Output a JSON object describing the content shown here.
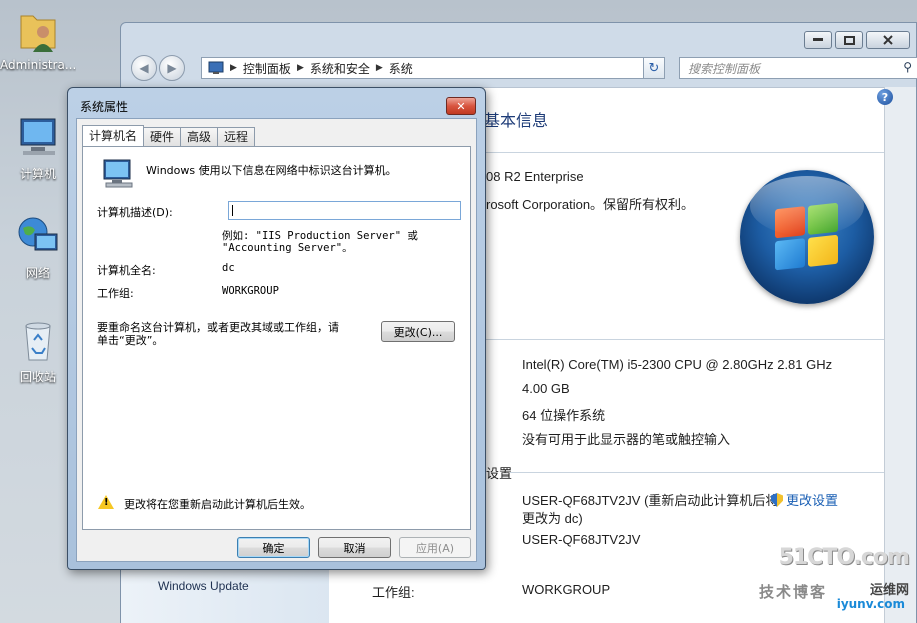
{
  "desktop": {
    "icons": [
      {
        "label": "Administra..."
      },
      {
        "label": "计算机"
      },
      {
        "label": "网络"
      },
      {
        "label": "回收站"
      }
    ]
  },
  "explorer": {
    "breadcrumb": [
      "控制面板",
      "系统和安全",
      "系统"
    ],
    "search_placeholder": "搜索控制面板",
    "section_title": "基本信息",
    "edition": "08 R2 Enterprise",
    "copyright": "rosoft Corporation。保留所有权利。",
    "processor": "Intel(R) Core(TM) i5-2300 CPU @ 2.80GHz   2.81 GHz",
    "memory": "4.00 GB",
    "system_type": "64 位操作系统",
    "pen_touch": "没有可用于此显示器的笔或触控输入",
    "settings_label": "设置",
    "computer_name": "USER-QF68JTV2JV (重新启动此计算机后将",
    "computer_name_cont": "更改为 dc)",
    "change_settings": "更改设置",
    "full_name": "USER-QF68JTV2JV",
    "workgroup_label": "工作组:",
    "workgroup_value": "WORKGROUP",
    "windows_update": "Windows Update"
  },
  "dialog": {
    "title": "系统属性",
    "tabs": [
      "计算机名",
      "硬件",
      "高级",
      "远程"
    ],
    "intro": "Windows 使用以下信息在网络中标识这台计算机。",
    "desc_label": "计算机描述(D):",
    "desc_value": "",
    "example_line1": "例如: \"IIS Production Server\" 或",
    "example_line2": "\"Accounting Server\"。",
    "full_name_label": "计算机全名:",
    "full_name_value": "dc",
    "workgroup_label": "工作组:",
    "workgroup_value": "WORKGROUP",
    "rename_line1": "要重命名这台计算机，或者更改其域或工作组，请",
    "rename_line2": "单击“更改”。",
    "change_button": "更改(C)...",
    "warning": "更改将在您重新启动此计算机后生效。",
    "ok": "确定",
    "cancel": "取消",
    "apply": "应用(A)"
  },
  "watermark": {
    "line1": "51CTO.com",
    "line2": "技术博客",
    "line3": "运维网",
    "line4": "iyunv.com"
  }
}
